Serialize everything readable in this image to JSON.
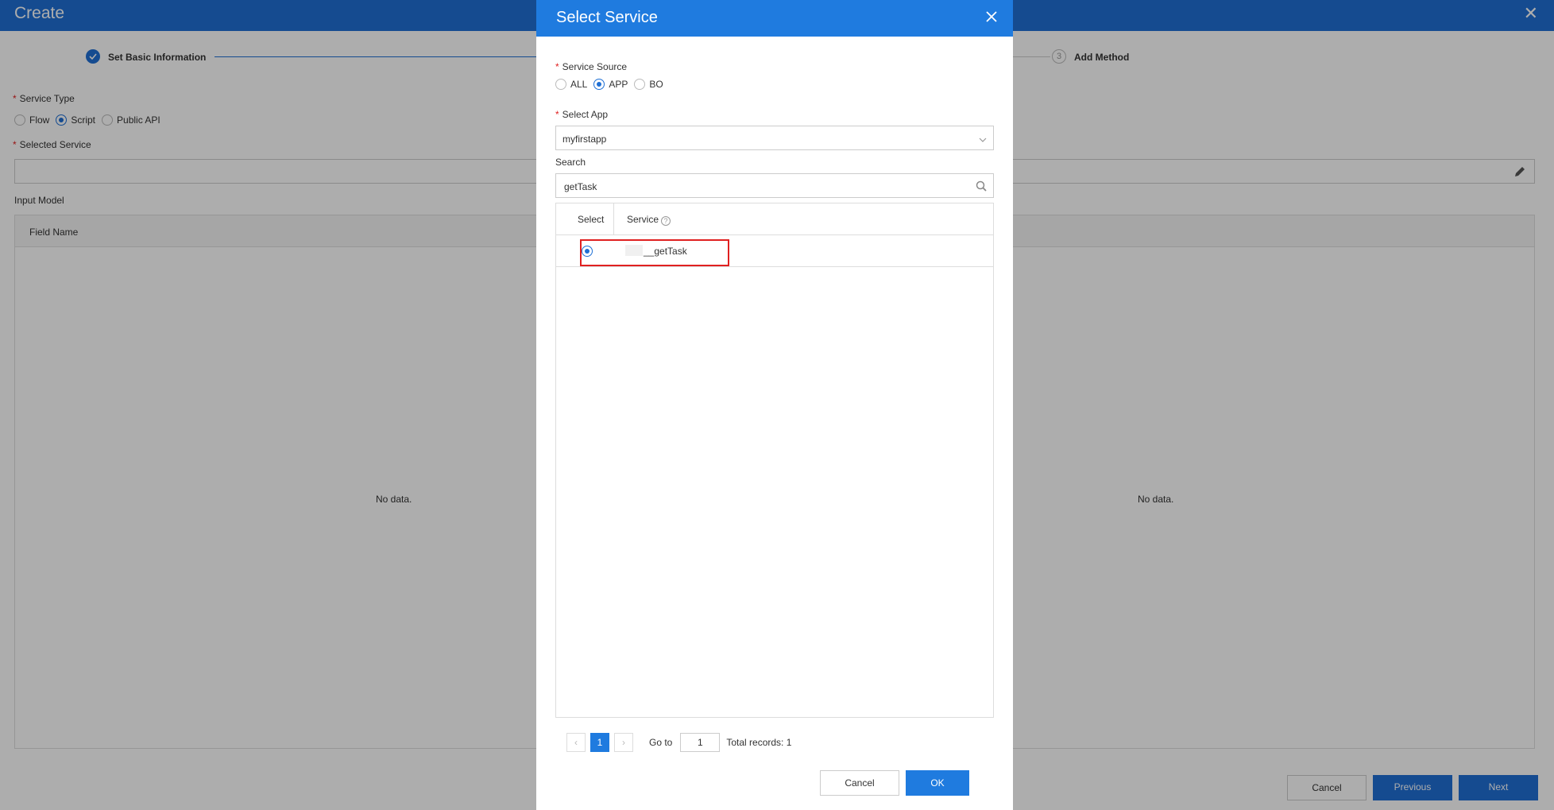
{
  "page": {
    "title": "Create",
    "steps": [
      {
        "label": "Set Basic Information"
      },
      {
        "number": "3",
        "label": "Add Method"
      }
    ],
    "service_type": {
      "label": "Service Type",
      "options": [
        "Flow",
        "Script",
        "Public API"
      ],
      "selected": "Script"
    },
    "selected_service_label": "Selected Service",
    "input_model_label": "Input Model",
    "field_name_header": "Field Name",
    "no_data": "No data.",
    "buttons": {
      "cancel": "Cancel",
      "previous": "Previous",
      "next": "Next"
    }
  },
  "dialog": {
    "title": "Select Service",
    "service_source": {
      "label": "Service Source",
      "options": [
        "ALL",
        "APP",
        "BO"
      ],
      "selected": "APP"
    },
    "select_app": {
      "label": "Select App",
      "value": "myfirstapp"
    },
    "search": {
      "label": "Search",
      "value": "getTask"
    },
    "table": {
      "columns": [
        "Select",
        "Service"
      ],
      "rows": [
        {
          "service": "__getTask",
          "selected": true
        }
      ]
    },
    "pagination": {
      "current_page": "1",
      "goto_label": "Go to",
      "goto_value": "1",
      "total": "Total records: 1"
    },
    "buttons": {
      "cancel": "Cancel",
      "ok": "OK"
    }
  },
  "colors": {
    "primary": "#1f7bdf",
    "highlight": "#e02020"
  }
}
